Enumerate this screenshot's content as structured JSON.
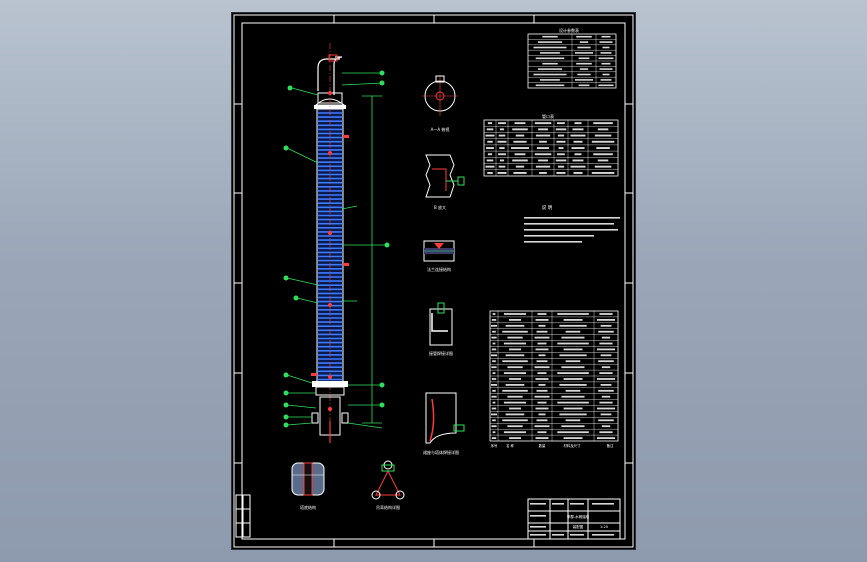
{
  "window": {
    "background": "#a3afbf",
    "sheet_color": "#000000"
  },
  "drawing": {
    "tables": {
      "top_right": {
        "title": "设计参数表",
        "header": [
          "名 称",
          "数 值"
        ]
      },
      "nozzle": {
        "title": "管口表"
      },
      "parts": {
        "footer": [
          "序号",
          "名 称",
          "数量",
          "材料及尺寸",
          "备注"
        ]
      }
    },
    "notes_title": "说 明",
    "views": {
      "top": "A—A 俯视",
      "side": "B 放大",
      "flange": "法兰连接结构",
      "nozzle_detail": "接管焊接详图",
      "skirt": "裙座与塔体焊接详图",
      "bottom_left": "塔底结构",
      "bottom_mid": "吊耳结构详图"
    },
    "title_block": {
      "drawing_name": "甲醇-水精馏塔",
      "label": "装配图",
      "scale": "1:20"
    }
  }
}
